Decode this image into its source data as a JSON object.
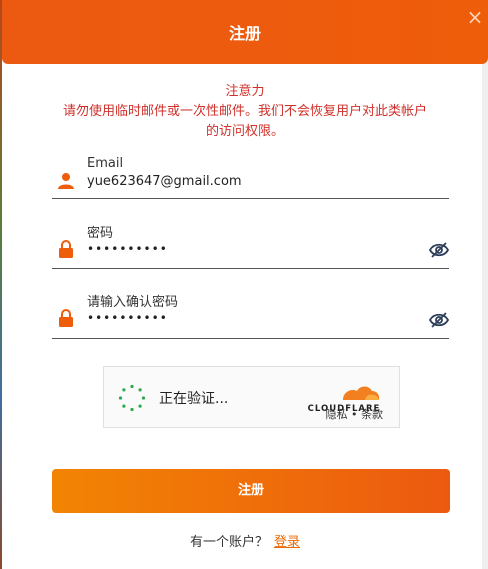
{
  "header": {
    "title": "注册",
    "close_icon": "close-icon"
  },
  "notice": {
    "title": "注意力",
    "line1": "请勿使用临时邮件或一次性邮件。我们不会恢复用户对此类帐户",
    "line2": "的访问权限。",
    "color": "#d0302a"
  },
  "form": {
    "email": {
      "label": "Email",
      "value": "yue623647@gmail.com",
      "icon": "user-icon"
    },
    "password": {
      "label": "密码",
      "value": "••••••••••",
      "icon": "lock-icon",
      "toggle_icon": "eye-off-icon"
    },
    "confirm": {
      "label": "请输入确认密码",
      "value": "••••••••••",
      "icon": "lock-icon",
      "toggle_icon": "eye-off-icon"
    }
  },
  "captcha": {
    "status": "正在验证...",
    "brand": "CLOUDFLARE",
    "privacy": "隐私",
    "separator": "•",
    "terms": "条款"
  },
  "submit_label": "注册",
  "footer": {
    "text": "有一个账户？",
    "link": "登录"
  },
  "colors": {
    "accent": "#ee5d0a",
    "link": "#ee6a07"
  }
}
